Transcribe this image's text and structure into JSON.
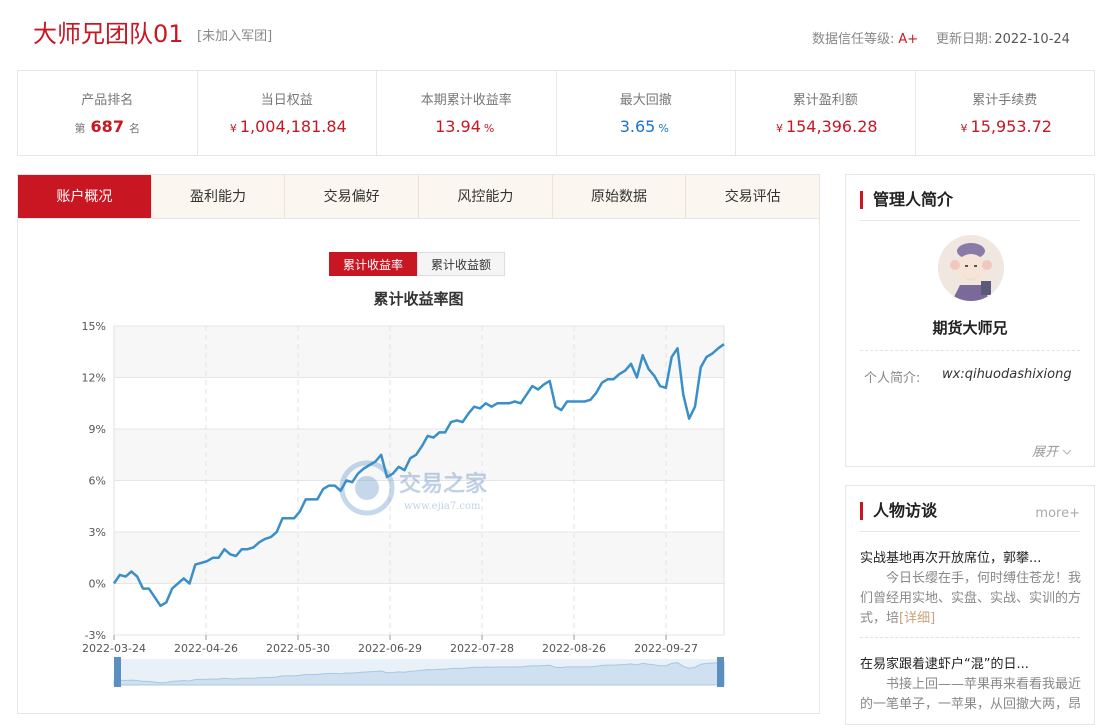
{
  "header": {
    "team_name": "大师兄团队01",
    "team_tag": "[未加入军团]",
    "credit_label": "数据信任等级:",
    "credit_grade": "A+",
    "update_label": "更新日期:",
    "update_date": "2022-10-24"
  },
  "stats": [
    {
      "label": "产品排名",
      "prefix": "第",
      "value": "687",
      "suffix": "名"
    },
    {
      "label": "当日权益",
      "currency": "¥",
      "value": "1,004,181.84"
    },
    {
      "label": "本期累计收益率",
      "value": "13.94",
      "unit": "%"
    },
    {
      "label": "最大回撤",
      "value": "3.65",
      "unit": "%"
    },
    {
      "label": "累计盈利额",
      "currency": "¥",
      "value": "154,396.28"
    },
    {
      "label": "累计手续费",
      "currency": "¥",
      "value": "15,953.72"
    }
  ],
  "tabs": [
    "账户概况",
    "盈利能力",
    "交易偏好",
    "风控能力",
    "原始数据",
    "交易评估"
  ],
  "toggle": {
    "rate": "累计收益率",
    "amount": "累计收益额"
  },
  "watermark": {
    "name": "交易之家",
    "url": "www.ejia7.com"
  },
  "colors": {
    "accent": "#c81623",
    "line": "#3a8fc8",
    "blue_value": "#1a74c9"
  },
  "chart_data": {
    "type": "line",
    "title": "累计收益率图",
    "y_ticks": [
      "15%",
      "12%",
      "9%",
      "6%",
      "3%",
      "0%",
      "-3%"
    ],
    "x_ticks": [
      "2022-03-24",
      "2022-04-26",
      "2022-05-30",
      "2022-06-29",
      "2022-07-28",
      "2022-08-26",
      "2022-09-27"
    ],
    "ylim": [
      -3,
      15
    ],
    "grid": true,
    "has_range_slider": true,
    "series": [
      {
        "values": [
          0.0,
          0.5,
          0.4,
          0.7,
          0.4,
          -0.3,
          -0.3,
          -0.8,
          -1.3,
          -1.1,
          -0.3,
          0.0,
          0.3,
          0.0,
          1.1,
          1.2,
          1.3,
          1.5,
          1.5,
          2.0,
          1.7,
          1.6,
          2.0,
          2.0,
          2.1,
          2.4,
          2.6,
          2.7,
          3.0,
          3.8,
          3.8,
          3.8,
          4.2,
          4.9,
          4.9,
          4.9,
          5.5,
          5.7,
          5.7,
          5.4,
          6.0,
          5.9,
          6.4,
          6.7,
          6.9,
          7.1,
          7.5,
          6.2,
          6.4,
          6.8,
          6.6,
          7.3,
          7.5,
          8.0,
          8.6,
          8.5,
          8.8,
          8.8,
          9.4,
          9.5,
          9.4,
          9.9,
          10.3,
          10.2,
          10.5,
          10.3,
          10.5,
          10.5,
          10.5,
          10.6,
          10.5,
          11.0,
          11.5,
          11.3,
          11.6,
          11.8,
          10.3,
          10.1,
          10.6,
          10.6,
          10.6,
          10.6,
          10.7,
          11.1,
          11.7,
          11.9,
          11.9,
          12.2,
          12.4,
          12.8,
          12.0,
          13.3,
          12.5,
          12.1,
          11.5,
          11.4,
          13.2,
          13.7,
          11.0,
          9.6,
          10.3,
          12.6,
          13.2,
          13.4,
          13.7,
          13.94
        ]
      }
    ]
  },
  "manager": {
    "section_title": "管理人简介",
    "name": "期货大师兄",
    "bio_label": "个人简介:",
    "bio": "wx:qihuodashixiong",
    "expand": "展开"
  },
  "interviews": {
    "section_title": "人物访谈",
    "more": "more+",
    "items": [
      {
        "title": "实战基地再次开放席位，郭攀...",
        "body": "今日长缨在手，何时缚住苍龙！我们曾经用实地、实盘、实战、实训的方式，培",
        "detail": "[详细]"
      },
      {
        "title": "在易家跟着逮虾户“混”的日...",
        "body": "书接上回——苹果再来看看我最近的一笔单子，一苹果，从回撤大两，昂"
      }
    ]
  }
}
